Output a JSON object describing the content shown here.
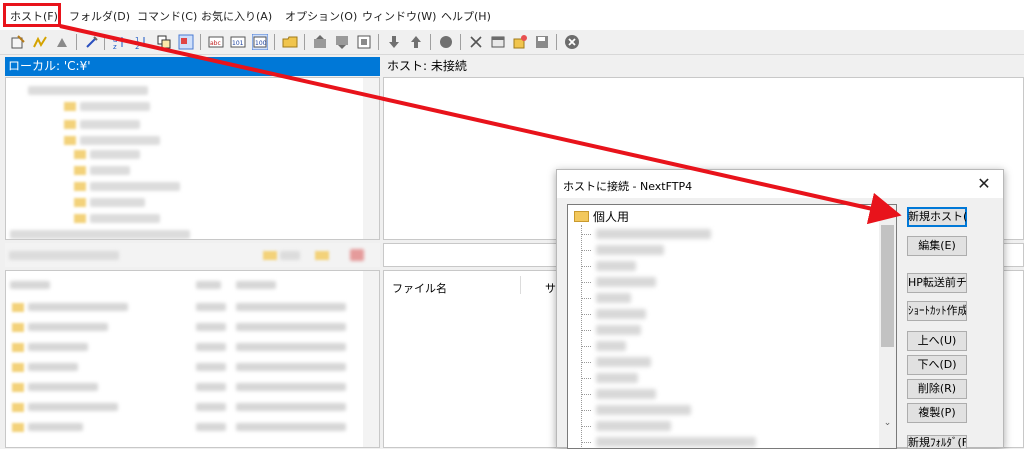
{
  "menu": {
    "items": [
      "ホスト(F)",
      "フォルダ(D)",
      "コマンド(C)",
      "お気に入り(A)",
      "オプション(O)",
      "ウィンドウ(W)",
      "ヘルプ(H)"
    ]
  },
  "toolbar": {
    "icons": [
      "connect-icon",
      "quick-connect-icon",
      "disconnect-icon",
      "edit-icon",
      "sort-asc-icon",
      "sort-desc-icon",
      "copy-icon",
      "view-icon",
      "text-icon",
      "binary-icon",
      "auto-mode-icon",
      "open-folder-icon",
      "upload-icon",
      "download-icon",
      "refresh-icon",
      "down-arrow-icon",
      "up-arrow-icon",
      "circle-icon",
      "cut-icon",
      "window-icon",
      "new-icon",
      "save-icon",
      "stop-icon"
    ]
  },
  "local_panel": {
    "title": "ローカル: 'C:¥'"
  },
  "host_panel": {
    "title": "ホスト: 未接続",
    "columns": [
      "ファイル名",
      "サ"
    ]
  },
  "dialog": {
    "title": "ホストに接続 - NextFTP4",
    "close_label": "✕",
    "tree_root": "個人用",
    "buttons": {
      "new_host": "新規ホスト(N)",
      "edit": "編集(E)",
      "hp_check": "HP転送前チェック",
      "shortcut": "ｼｮｰﾄｶｯﾄ作成",
      "up": "上へ(U)",
      "down": "下へ(D)",
      "delete": "削除(R)",
      "duplicate": "複製(P)",
      "new_folder": "新規ﾌｫﾙﾀﾞ(F)"
    }
  },
  "colors": {
    "highlight": "#e8131b",
    "selection": "#0078d7"
  }
}
